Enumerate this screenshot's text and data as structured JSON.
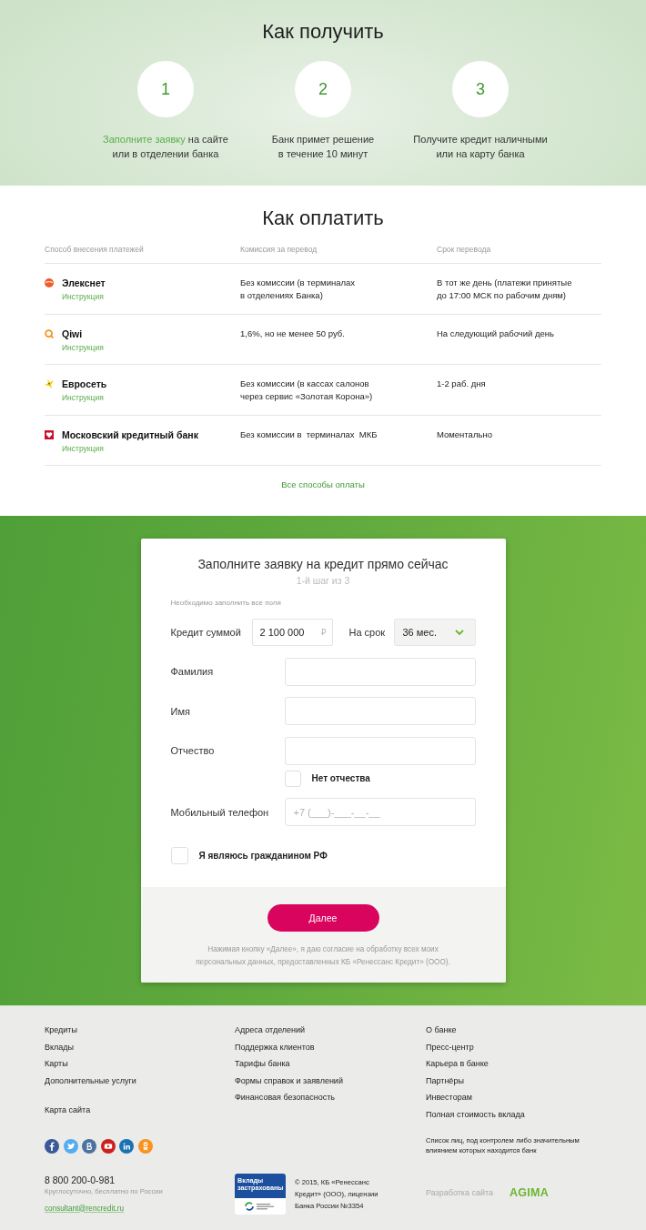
{
  "how_to_get": {
    "title": "Как получить",
    "steps": [
      {
        "number": "1",
        "link": "Заполните заявку",
        "text": "на сайте\nили в отделении банка"
      },
      {
        "number": "2",
        "text": "Банк примет решение\nв течение 10 минут"
      },
      {
        "number": "3",
        "text": "Получите кредит наличными\nили на карту банка"
      }
    ]
  },
  "how_to_pay": {
    "title": "Как оплатить",
    "columns": [
      "Способ внесения платежей",
      "Комиссия за перевод",
      "Срок перевода"
    ],
    "rows": [
      {
        "name": "Элекснет",
        "link": "Инструкция",
        "commission": "Без комиссии (в терминалах\nв отделениях Банка)",
        "term": "В тот же день (платежи принятые\nдо 17:00 МСК по рабочим дням)"
      },
      {
        "name": "Qiwi",
        "link": "Инструкция",
        "commission": "1,6%, но не менее 50 руб.",
        "term": "На следующий рабочий день"
      },
      {
        "name": "Евросеть",
        "link": "Инструкция",
        "commission": "Без комиссии (в кассах салонов\nчерез сервис «Золотая Корона»)",
        "term": "1-2 раб. дня"
      },
      {
        "name": "Московский кредитный банк",
        "link": "Инструкция",
        "commission": "Без комиссии в  терминалах  МКБ",
        "term": "Моментально"
      }
    ],
    "all_link": "Все способы оплаты"
  },
  "application_form": {
    "title": "Заполните заявку на кредит прямо сейчас",
    "step": "1-й шаг из 3",
    "note": "Необходимо заполнить все поля",
    "amount": {
      "label": "Кредит суммой",
      "value": "2 100 000",
      "currency": "₽"
    },
    "term": {
      "label": "На срок",
      "value": "36 мес."
    },
    "fields": [
      {
        "kind": "text",
        "label": "Фамилия"
      },
      {
        "kind": "text",
        "label": "Имя"
      },
      {
        "kind": "text",
        "label": "Отчество"
      },
      {
        "kind": "checkbox",
        "label": "Нет отчества",
        "checked": false
      },
      {
        "kind": "text",
        "label": "Мобильный телефон",
        "placeholder": "+7 (___)-___-__-__"
      }
    ],
    "citizen": {
      "label": "Я являюсь гражданином РФ",
      "checked": false
    },
    "submit": "Далее",
    "consent": "Нажимая кнопку «Далее», я даю согласие на обработку всех моих\nперсональных данных, предоставленных КБ «Ренессанс Кредит» (ООО)."
  },
  "footer": {
    "columns": [
      {
        "links": [
          "Кредиты",
          "Вклады",
          "Карты",
          "Дополнительные услуги"
        ],
        "extra": "Карта сайта"
      },
      {
        "links": [
          "Адреса отделений",
          "Поддержка клиентов",
          "Тарифы банка",
          "Формы справок и заявлений",
          "Финансовая безопасность"
        ]
      },
      {
        "links": [
          "О банке",
          "Пресс-центр",
          "Карьера в банке",
          "Партнёры",
          "Инвесторам",
          "Полная стоимость вклада"
        ]
      }
    ],
    "control_list_link": "Список лиц, под контролем либо значительным\nвлиянием которых находится банк",
    "phone": "8 800 200-0-981",
    "phone_note": "Круглосуточно, бесплатно по России",
    "email": "consultant@rencredit.ru",
    "insurance_badge": "Вклады\nзастрахованы",
    "copyright": "© 2015, КБ «Ренессанс\nКредит» (ООО), лицензии\nБанка России №3354",
    "developer_label": "Разработка сайта",
    "developer": "AGIMA"
  }
}
